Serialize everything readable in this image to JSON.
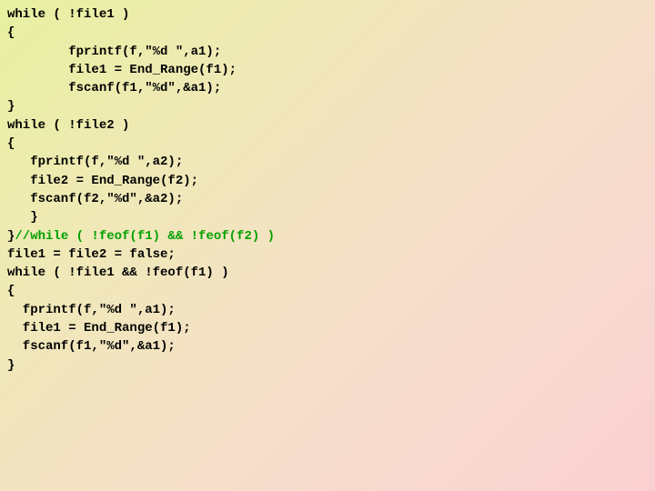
{
  "code": {
    "lines": [
      {
        "text": "while ( !file1 )",
        "indent": 0,
        "comment": false
      },
      {
        "text": "{",
        "indent": 0,
        "comment": false
      },
      {
        "text": "fprintf(f,\"%d \",a1);",
        "indent": 8,
        "comment": false
      },
      {
        "text": "file1 = End_Range(f1);",
        "indent": 8,
        "comment": false
      },
      {
        "text": "fscanf(f1,\"%d\",&a1);",
        "indent": 8,
        "comment": false
      },
      {
        "text": "}",
        "indent": 0,
        "comment": false
      },
      {
        "text": "",
        "indent": 0,
        "comment": false
      },
      {
        "text": "while ( !file2 )",
        "indent": 0,
        "comment": false
      },
      {
        "text": "{",
        "indent": 0,
        "comment": false
      },
      {
        "text": "fprintf(f,\"%d \",a2);",
        "indent": 3,
        "comment": false
      },
      {
        "text": "file2 = End_Range(f2);",
        "indent": 3,
        "comment": false
      },
      {
        "text": "fscanf(f2,\"%d\",&a2);",
        "indent": 3,
        "comment": false
      },
      {
        "text": "}",
        "indent": 3,
        "comment": false
      },
      {
        "text": "}",
        "indent": 0,
        "comment": false,
        "trailing_comment": "//while ( !feof(f1) && !feof(f2) )"
      },
      {
        "text": "",
        "indent": 0,
        "comment": false
      },
      {
        "text": "",
        "indent": 0,
        "comment": false
      },
      {
        "text": "file1 = file2 = false;",
        "indent": 0,
        "comment": false
      },
      {
        "text": "",
        "indent": 0,
        "comment": false
      },
      {
        "text": "while ( !file1 && !feof(f1) )",
        "indent": 0,
        "comment": false
      },
      {
        "text": "{",
        "indent": 0,
        "comment": false
      },
      {
        "text": "fprintf(f,\"%d \",a1);",
        "indent": 2,
        "comment": false
      },
      {
        "text": "file1 = End_Range(f1);",
        "indent": 2,
        "comment": false
      },
      {
        "text": "fscanf(f1,\"%d\",&a1);",
        "indent": 2,
        "comment": false
      },
      {
        "text": "}",
        "indent": 0,
        "comment": false
      }
    ]
  }
}
